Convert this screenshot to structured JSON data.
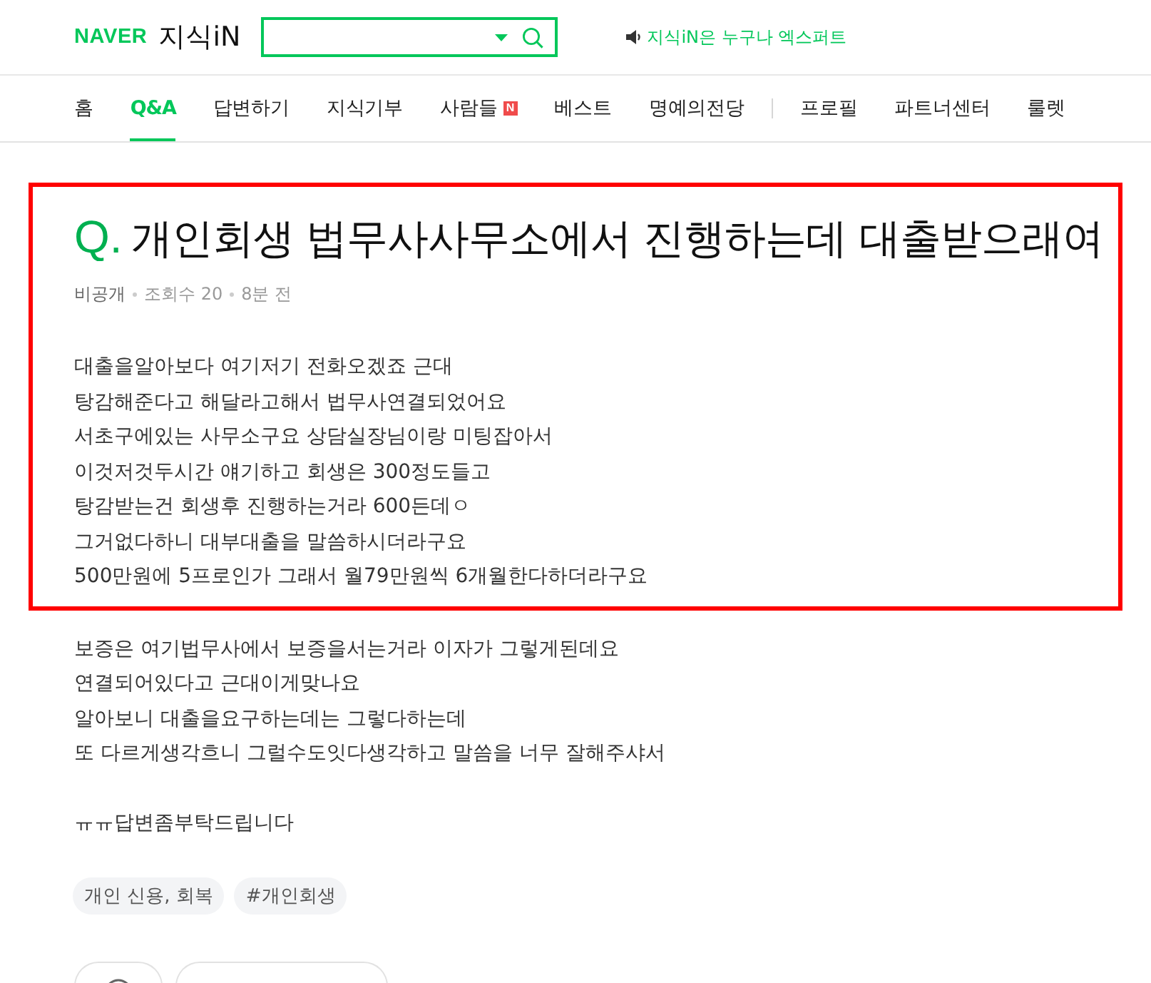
{
  "header": {
    "logo": "NAVER",
    "service": "지식iN",
    "notice": "지식iN은 누구나 엑스퍼트"
  },
  "nav": [
    [
      {
        "label": "홈",
        "selected": false
      },
      {
        "label": "Q&A",
        "selected": true
      },
      {
        "label": "답변하기",
        "selected": false
      },
      {
        "label": "지식기부",
        "selected": false
      },
      {
        "label": "사람들",
        "selected": false,
        "badge": "N"
      },
      {
        "label": "베스트",
        "selected": false
      },
      {
        "label": "명예의전당",
        "selected": false
      }
    ],
    [
      {
        "label": "프로필",
        "selected": false
      },
      {
        "label": "파트너센터",
        "selected": false
      },
      {
        "label": "룰렛",
        "selected": false
      }
    ]
  ],
  "question": {
    "marker": "Q.",
    "title": "개인회생 법무사사무소에서 진행하는데 대출받으래여",
    "meta": [
      "비공개",
      "조회수 20",
      "8분 전"
    ],
    "highlighted_lines": [
      "대출을알아보다 여기저기 전화오겠죠 근대",
      "탕감해준다고 해달라고해서 법무사연결되었어요",
      "서초구에있는 사무소구요 상담실장님이랑 미팅잡아서",
      "이것저것두시간 얘기하고 회생은 300정도들고",
      "탕감받는건 회생후 진행하는거라 600든데ㅇ",
      "그거없다하니 대부대출을 말씀하시더라구요",
      "500만원에 5프로인가 그래서 월79만원씩 6개월한다하더라구요"
    ],
    "paragraphs": [
      [
        "보증은 여기법무사에서 보증을서는거라 이자가 그렇게된데요",
        "연결되어있다고 근대이게맞나요",
        "알아보니 대출을요구하는데는 그렇다하는데",
        "또 다르게생각흐니 그럴수도잇다생각하고 말씀을 너무 잘해주샤서"
      ],
      [
        "ㅠㅠ답변좀부탁드립니다"
      ]
    ]
  },
  "tags": [
    "개인 신용, 회복",
    "#개인회생"
  ]
}
